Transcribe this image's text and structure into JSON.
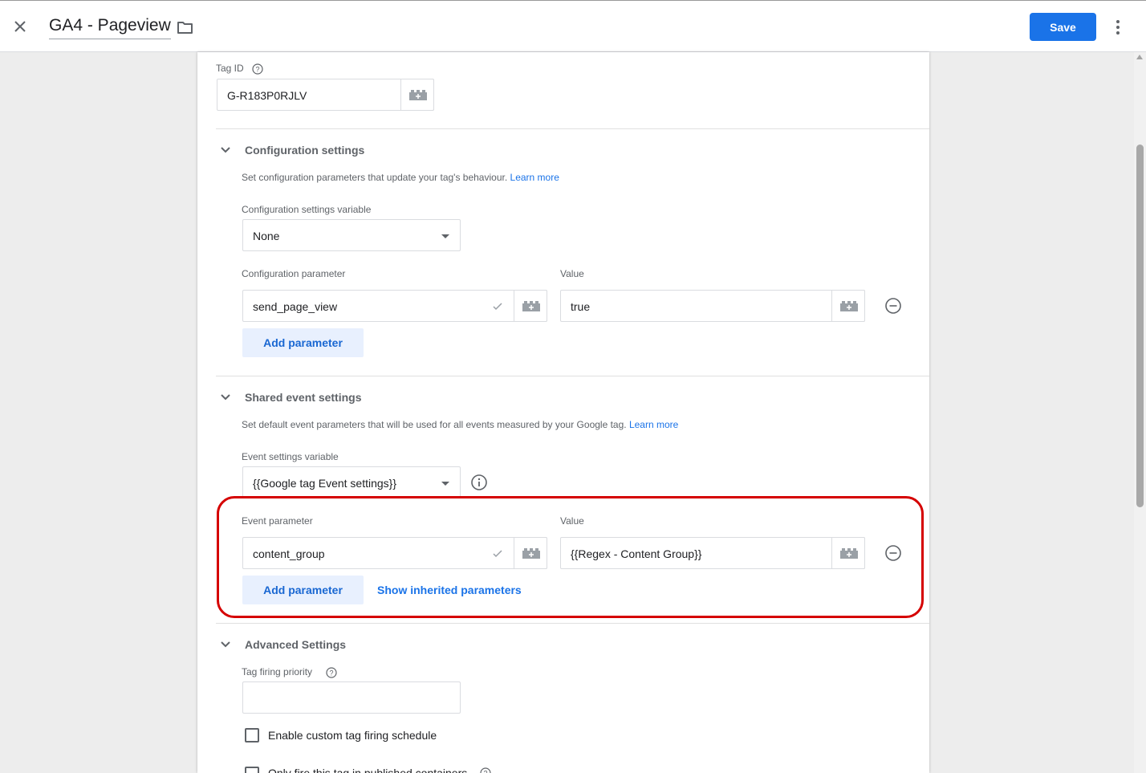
{
  "header": {
    "title": "GA4 - Pageview",
    "save_label": "Save"
  },
  "tag_id": {
    "label": "Tag ID",
    "value": "G-R183P0RJLV"
  },
  "config": {
    "title": "Configuration settings",
    "description": "Set configuration parameters that update your tag's behaviour.",
    "learn_more": "Learn more",
    "variable_label": "Configuration settings variable",
    "variable_value": "None",
    "param_label": "Configuration parameter",
    "value_label": "Value",
    "param_value": "send_page_view",
    "value_value": "true",
    "add_label": "Add parameter"
  },
  "shared": {
    "title": "Shared event settings",
    "description": "Set default event parameters that will be used for all events measured by your Google tag.",
    "learn_more": "Learn more",
    "variable_label": "Event settings variable",
    "variable_value": "{{Google tag Event settings}}",
    "param_label": "Event parameter",
    "value_label": "Value",
    "param_value": "content_group",
    "value_value": "{{Regex - Content Group}}",
    "add_label": "Add parameter",
    "show_inherited": "Show inherited parameters"
  },
  "advanced": {
    "title": "Advanced Settings",
    "priority_label": "Tag firing priority",
    "priority_value": "",
    "schedule_label": "Enable custom tag firing schedule",
    "published_label": "Only fire this tag in published containers"
  },
  "colors": {
    "accent": "#1a73e8",
    "highlight": "#d50000"
  }
}
